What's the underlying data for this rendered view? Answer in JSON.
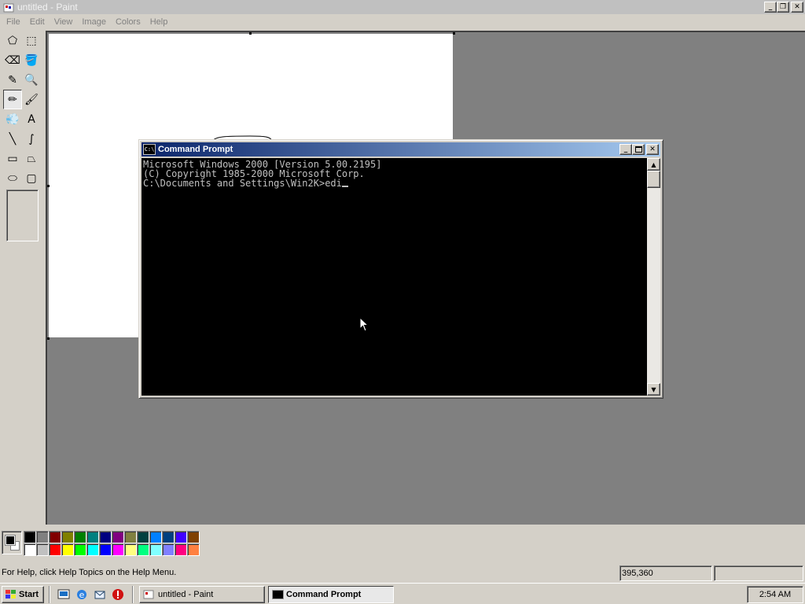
{
  "paint": {
    "title": "untitled - Paint",
    "window_buttons": {
      "minimize": "_",
      "restore": "❐",
      "close": "✕"
    },
    "menu": [
      "File",
      "Edit",
      "View",
      "Image",
      "Colors",
      "Help"
    ],
    "tools": [
      {
        "name": "free-select-tool",
        "glyph": "⬠"
      },
      {
        "name": "rect-select-tool",
        "glyph": "⬚"
      },
      {
        "name": "eraser-tool",
        "glyph": "⌫"
      },
      {
        "name": "fill-tool",
        "glyph": "🪣"
      },
      {
        "name": "pick-color-tool",
        "glyph": "✎"
      },
      {
        "name": "magnifier-tool",
        "glyph": "🔍"
      },
      {
        "name": "pencil-tool",
        "glyph": "✏"
      },
      {
        "name": "brush-tool",
        "glyph": "🖌"
      },
      {
        "name": "airbrush-tool",
        "glyph": "💨"
      },
      {
        "name": "text-tool",
        "glyph": "A"
      },
      {
        "name": "line-tool",
        "glyph": "╲"
      },
      {
        "name": "curve-tool",
        "glyph": "∫"
      },
      {
        "name": "rectangle-tool",
        "glyph": "▭"
      },
      {
        "name": "polygon-tool",
        "glyph": "⏢"
      },
      {
        "name": "ellipse-tool",
        "glyph": "⬭"
      },
      {
        "name": "rounded-rect-tool",
        "glyph": "▢"
      }
    ],
    "active_tool": "pencil-tool",
    "palette_colors": [
      "#000000",
      "#808080",
      "#800000",
      "#808000",
      "#008000",
      "#008080",
      "#000080",
      "#800080",
      "#808040",
      "#004040",
      "#0080ff",
      "#004080",
      "#4000ff",
      "#804000",
      "#ffffff",
      "#c0c0c0",
      "#ff0000",
      "#ffff00",
      "#00ff00",
      "#00ffff",
      "#0000ff",
      "#ff00ff",
      "#ffff80",
      "#00ff80",
      "#80ffff",
      "#8080ff",
      "#ff0080",
      "#ff8040"
    ],
    "foreground_color": "#000000",
    "background_color": "#ffffff",
    "status_help": "For Help, click Help Topics on the Help Menu.",
    "status_coords": "395,360"
  },
  "cmd": {
    "title": "Command Prompt",
    "icon_text": "C:\\",
    "lines": [
      "Microsoft Windows 2000 [Version 5.00.2195]",
      "(C) Copyright 1985-2000 Microsoft Corp.",
      "",
      "C:\\Documents and Settings\\Win2K>edi"
    ]
  },
  "taskbar": {
    "start_label": "Start",
    "quick_launch": [
      "desktop-icon",
      "ie-icon",
      "outlook-icon",
      "stop-icon"
    ],
    "tasks": [
      {
        "label": "untitled - Paint",
        "active": false
      },
      {
        "label": "Command Prompt",
        "active": true
      }
    ],
    "clock": "2:54 AM"
  }
}
